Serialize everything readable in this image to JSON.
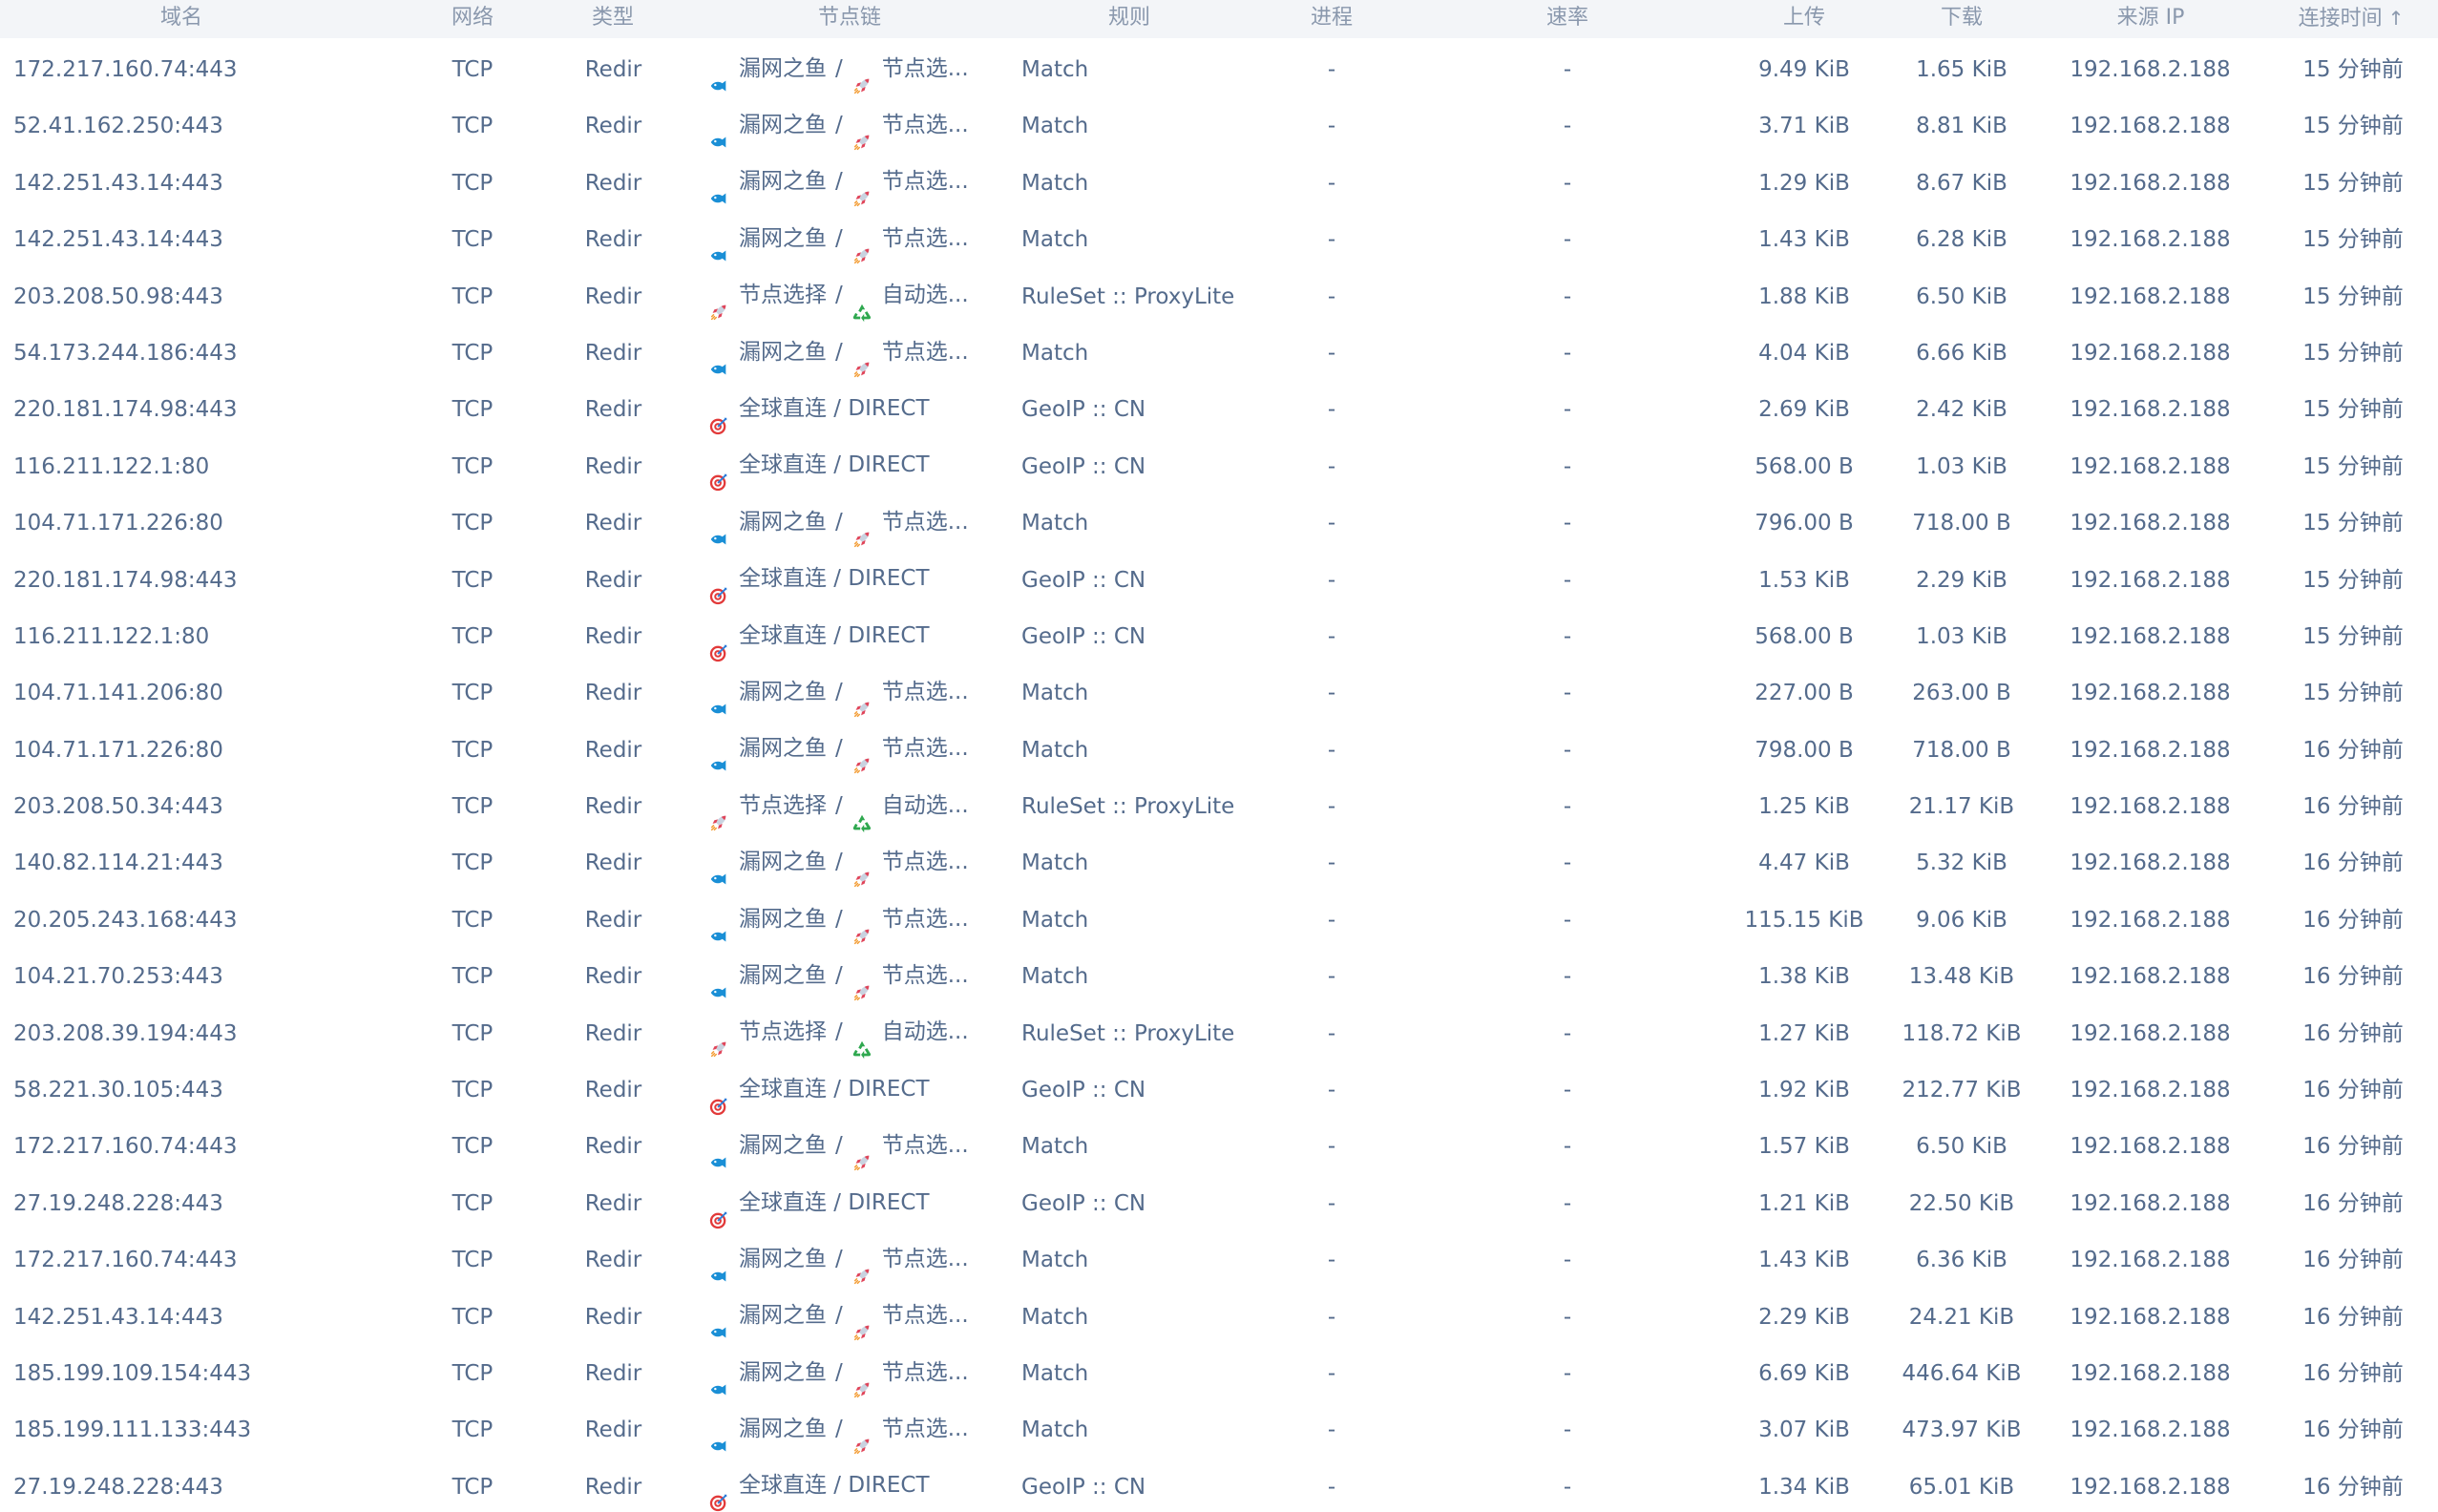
{
  "columns": [
    {
      "key": "host",
      "label": "域名",
      "center": 190
    },
    {
      "key": "network",
      "label": "网络",
      "center": 495
    },
    {
      "key": "type",
      "label": "类型",
      "center": 642
    },
    {
      "key": "chain",
      "label": "节点链",
      "center": 890
    },
    {
      "key": "rule",
      "label": "规则",
      "center": 1183
    },
    {
      "key": "progress",
      "label": "进程",
      "center": 1395
    },
    {
      "key": "rate",
      "label": "速率",
      "center": 1642
    },
    {
      "key": "upload",
      "label": "上传",
      "center": 1890
    },
    {
      "key": "download",
      "label": "下载",
      "center": 2055
    },
    {
      "key": "source_ip",
      "label": "来源 IP",
      "center": 2253
    },
    {
      "key": "time",
      "label": "连接时间",
      "center": 2463,
      "sort": "↑"
    }
  ],
  "icons": {
    "fish": {
      "name": "fish-icon",
      "color": "#1a8fd6"
    },
    "rocket": {
      "name": "rocket-icon",
      "color": "#e0455a"
    },
    "target": {
      "name": "target-icon",
      "color": "#e23a3a"
    },
    "recycle": {
      "name": "recycle-icon",
      "color": "#2fa84f"
    }
  },
  "rows": [
    {
      "host": "172.217.160.74:443",
      "network": "TCP",
      "type": "Redir",
      "chain": [
        {
          "icon": "fish",
          "text": "漏网之鱼"
        },
        {
          "icon": "rocket",
          "text": "节点选..."
        }
      ],
      "rule": "Match",
      "progress": "-",
      "rate": "-",
      "upload": "9.49 KiB",
      "download": "1.65 KiB",
      "source_ip": "192.168.2.188",
      "time": "15 分钟前"
    },
    {
      "host": "52.41.162.250:443",
      "network": "TCP",
      "type": "Redir",
      "chain": [
        {
          "icon": "fish",
          "text": "漏网之鱼"
        },
        {
          "icon": "rocket",
          "text": "节点选..."
        }
      ],
      "rule": "Match",
      "progress": "-",
      "rate": "-",
      "upload": "3.71 KiB",
      "download": "8.81 KiB",
      "source_ip": "192.168.2.188",
      "time": "15 分钟前"
    },
    {
      "host": "142.251.43.14:443",
      "network": "TCP",
      "type": "Redir",
      "chain": [
        {
          "icon": "fish",
          "text": "漏网之鱼"
        },
        {
          "icon": "rocket",
          "text": "节点选..."
        }
      ],
      "rule": "Match",
      "progress": "-",
      "rate": "-",
      "upload": "1.29 KiB",
      "download": "8.67 KiB",
      "source_ip": "192.168.2.188",
      "time": "15 分钟前"
    },
    {
      "host": "142.251.43.14:443",
      "network": "TCP",
      "type": "Redir",
      "chain": [
        {
          "icon": "fish",
          "text": "漏网之鱼"
        },
        {
          "icon": "rocket",
          "text": "节点选..."
        }
      ],
      "rule": "Match",
      "progress": "-",
      "rate": "-",
      "upload": "1.43 KiB",
      "download": "6.28 KiB",
      "source_ip": "192.168.2.188",
      "time": "15 分钟前"
    },
    {
      "host": "203.208.50.98:443",
      "network": "TCP",
      "type": "Redir",
      "chain": [
        {
          "icon": "rocket",
          "text": "节点选择"
        },
        {
          "icon": "recycle",
          "text": "自动选..."
        }
      ],
      "rule": "RuleSet :: ProxyLite",
      "progress": "-",
      "rate": "-",
      "upload": "1.88 KiB",
      "download": "6.50 KiB",
      "source_ip": "192.168.2.188",
      "time": "15 分钟前"
    },
    {
      "host": "54.173.244.186:443",
      "network": "TCP",
      "type": "Redir",
      "chain": [
        {
          "icon": "fish",
          "text": "漏网之鱼"
        },
        {
          "icon": "rocket",
          "text": "节点选..."
        }
      ],
      "rule": "Match",
      "progress": "-",
      "rate": "-",
      "upload": "4.04 KiB",
      "download": "6.66 KiB",
      "source_ip": "192.168.2.188",
      "time": "15 分钟前"
    },
    {
      "host": "220.181.174.98:443",
      "network": "TCP",
      "type": "Redir",
      "chain": [
        {
          "icon": "target",
          "text": "全球直连 / DIRECT"
        }
      ],
      "rule": "GeoIP :: CN",
      "progress": "-",
      "rate": "-",
      "upload": "2.69 KiB",
      "download": "2.42 KiB",
      "source_ip": "192.168.2.188",
      "time": "15 分钟前"
    },
    {
      "host": "116.211.122.1:80",
      "network": "TCP",
      "type": "Redir",
      "chain": [
        {
          "icon": "target",
          "text": "全球直连 / DIRECT"
        }
      ],
      "rule": "GeoIP :: CN",
      "progress": "-",
      "rate": "-",
      "upload": "568.00 B",
      "download": "1.03 KiB",
      "source_ip": "192.168.2.188",
      "time": "15 分钟前"
    },
    {
      "host": "104.71.171.226:80",
      "network": "TCP",
      "type": "Redir",
      "chain": [
        {
          "icon": "fish",
          "text": "漏网之鱼"
        },
        {
          "icon": "rocket",
          "text": "节点选..."
        }
      ],
      "rule": "Match",
      "progress": "-",
      "rate": "-",
      "upload": "796.00 B",
      "download": "718.00 B",
      "source_ip": "192.168.2.188",
      "time": "15 分钟前"
    },
    {
      "host": "220.181.174.98:443",
      "network": "TCP",
      "type": "Redir",
      "chain": [
        {
          "icon": "target",
          "text": "全球直连 / DIRECT"
        }
      ],
      "rule": "GeoIP :: CN",
      "progress": "-",
      "rate": "-",
      "upload": "1.53 KiB",
      "download": "2.29 KiB",
      "source_ip": "192.168.2.188",
      "time": "15 分钟前"
    },
    {
      "host": "116.211.122.1:80",
      "network": "TCP",
      "type": "Redir",
      "chain": [
        {
          "icon": "target",
          "text": "全球直连 / DIRECT"
        }
      ],
      "rule": "GeoIP :: CN",
      "progress": "-",
      "rate": "-",
      "upload": "568.00 B",
      "download": "1.03 KiB",
      "source_ip": "192.168.2.188",
      "time": "15 分钟前"
    },
    {
      "host": "104.71.141.206:80",
      "network": "TCP",
      "type": "Redir",
      "chain": [
        {
          "icon": "fish",
          "text": "漏网之鱼"
        },
        {
          "icon": "rocket",
          "text": "节点选..."
        }
      ],
      "rule": "Match",
      "progress": "-",
      "rate": "-",
      "upload": "227.00 B",
      "download": "263.00 B",
      "source_ip": "192.168.2.188",
      "time": "15 分钟前"
    },
    {
      "host": "104.71.171.226:80",
      "network": "TCP",
      "type": "Redir",
      "chain": [
        {
          "icon": "fish",
          "text": "漏网之鱼"
        },
        {
          "icon": "rocket",
          "text": "节点选..."
        }
      ],
      "rule": "Match",
      "progress": "-",
      "rate": "-",
      "upload": "798.00 B",
      "download": "718.00 B",
      "source_ip": "192.168.2.188",
      "time": "16 分钟前"
    },
    {
      "host": "203.208.50.34:443",
      "network": "TCP",
      "type": "Redir",
      "chain": [
        {
          "icon": "rocket",
          "text": "节点选择"
        },
        {
          "icon": "recycle",
          "text": "自动选..."
        }
      ],
      "rule": "RuleSet :: ProxyLite",
      "progress": "-",
      "rate": "-",
      "upload": "1.25 KiB",
      "download": "21.17 KiB",
      "source_ip": "192.168.2.188",
      "time": "16 分钟前"
    },
    {
      "host": "140.82.114.21:443",
      "network": "TCP",
      "type": "Redir",
      "chain": [
        {
          "icon": "fish",
          "text": "漏网之鱼"
        },
        {
          "icon": "rocket",
          "text": "节点选..."
        }
      ],
      "rule": "Match",
      "progress": "-",
      "rate": "-",
      "upload": "4.47 KiB",
      "download": "5.32 KiB",
      "source_ip": "192.168.2.188",
      "time": "16 分钟前"
    },
    {
      "host": "20.205.243.168:443",
      "network": "TCP",
      "type": "Redir",
      "chain": [
        {
          "icon": "fish",
          "text": "漏网之鱼"
        },
        {
          "icon": "rocket",
          "text": "节点选..."
        }
      ],
      "rule": "Match",
      "progress": "-",
      "rate": "-",
      "upload": "115.15 KiB",
      "download": "9.06 KiB",
      "source_ip": "192.168.2.188",
      "time": "16 分钟前"
    },
    {
      "host": "104.21.70.253:443",
      "network": "TCP",
      "type": "Redir",
      "chain": [
        {
          "icon": "fish",
          "text": "漏网之鱼"
        },
        {
          "icon": "rocket",
          "text": "节点选..."
        }
      ],
      "rule": "Match",
      "progress": "-",
      "rate": "-",
      "upload": "1.38 KiB",
      "download": "13.48 KiB",
      "source_ip": "192.168.2.188",
      "time": "16 分钟前"
    },
    {
      "host": "203.208.39.194:443",
      "network": "TCP",
      "type": "Redir",
      "chain": [
        {
          "icon": "rocket",
          "text": "节点选择"
        },
        {
          "icon": "recycle",
          "text": "自动选..."
        }
      ],
      "rule": "RuleSet :: ProxyLite",
      "progress": "-",
      "rate": "-",
      "upload": "1.27 KiB",
      "download": "118.72 KiB",
      "source_ip": "192.168.2.188",
      "time": "16 分钟前"
    },
    {
      "host": "58.221.30.105:443",
      "network": "TCP",
      "type": "Redir",
      "chain": [
        {
          "icon": "target",
          "text": "全球直连 / DIRECT"
        }
      ],
      "rule": "GeoIP :: CN",
      "progress": "-",
      "rate": "-",
      "upload": "1.92 KiB",
      "download": "212.77 KiB",
      "source_ip": "192.168.2.188",
      "time": "16 分钟前"
    },
    {
      "host": "172.217.160.74:443",
      "network": "TCP",
      "type": "Redir",
      "chain": [
        {
          "icon": "fish",
          "text": "漏网之鱼"
        },
        {
          "icon": "rocket",
          "text": "节点选..."
        }
      ],
      "rule": "Match",
      "progress": "-",
      "rate": "-",
      "upload": "1.57 KiB",
      "download": "6.50 KiB",
      "source_ip": "192.168.2.188",
      "time": "16 分钟前"
    },
    {
      "host": "27.19.248.228:443",
      "network": "TCP",
      "type": "Redir",
      "chain": [
        {
          "icon": "target",
          "text": "全球直连 / DIRECT"
        }
      ],
      "rule": "GeoIP :: CN",
      "progress": "-",
      "rate": "-",
      "upload": "1.21 KiB",
      "download": "22.50 KiB",
      "source_ip": "192.168.2.188",
      "time": "16 分钟前"
    },
    {
      "host": "172.217.160.74:443",
      "network": "TCP",
      "type": "Redir",
      "chain": [
        {
          "icon": "fish",
          "text": "漏网之鱼"
        },
        {
          "icon": "rocket",
          "text": "节点选..."
        }
      ],
      "rule": "Match",
      "progress": "-",
      "rate": "-",
      "upload": "1.43 KiB",
      "download": "6.36 KiB",
      "source_ip": "192.168.2.188",
      "time": "16 分钟前"
    },
    {
      "host": "142.251.43.14:443",
      "network": "TCP",
      "type": "Redir",
      "chain": [
        {
          "icon": "fish",
          "text": "漏网之鱼"
        },
        {
          "icon": "rocket",
          "text": "节点选..."
        }
      ],
      "rule": "Match",
      "progress": "-",
      "rate": "-",
      "upload": "2.29 KiB",
      "download": "24.21 KiB",
      "source_ip": "192.168.2.188",
      "time": "16 分钟前"
    },
    {
      "host": "185.199.109.154:443",
      "network": "TCP",
      "type": "Redir",
      "chain": [
        {
          "icon": "fish",
          "text": "漏网之鱼"
        },
        {
          "icon": "rocket",
          "text": "节点选..."
        }
      ],
      "rule": "Match",
      "progress": "-",
      "rate": "-",
      "upload": "6.69 KiB",
      "download": "446.64 KiB",
      "source_ip": "192.168.2.188",
      "time": "16 分钟前"
    },
    {
      "host": "185.199.111.133:443",
      "network": "TCP",
      "type": "Redir",
      "chain": [
        {
          "icon": "fish",
          "text": "漏网之鱼"
        },
        {
          "icon": "rocket",
          "text": "节点选..."
        }
      ],
      "rule": "Match",
      "progress": "-",
      "rate": "-",
      "upload": "3.07 KiB",
      "download": "473.97 KiB",
      "source_ip": "192.168.2.188",
      "time": "16 分钟前"
    },
    {
      "host": "27.19.248.228:443",
      "network": "TCP",
      "type": "Redir",
      "chain": [
        {
          "icon": "target",
          "text": "全球直连 / DIRECT"
        }
      ],
      "rule": "GeoIP :: CN",
      "progress": "-",
      "rate": "-",
      "upload": "1.34 KiB",
      "download": "65.01 KiB",
      "source_ip": "192.168.2.188",
      "time": "16 分钟前"
    }
  ]
}
